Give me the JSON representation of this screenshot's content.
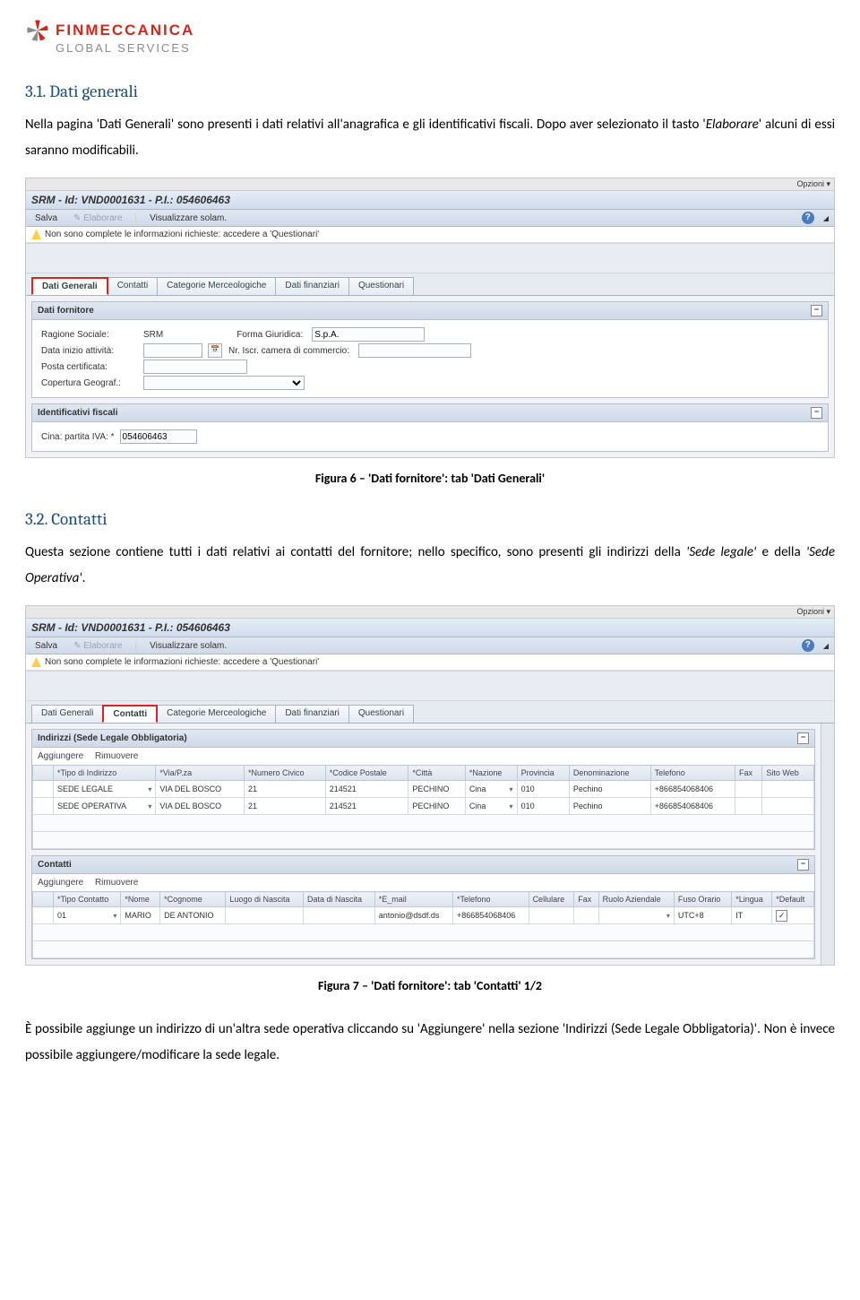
{
  "logo": {
    "brand": "FINMECCANICA",
    "sub": "GLOBAL SERVICES"
  },
  "section1": {
    "num": "3.1.",
    "title": "Dati generali",
    "para": "Nella pagina 'Dati Generali' sono presenti i dati relativi all'anagrafica e gli identificativi fiscali. Dopo aver selezionato il tasto 'Elaborare' alcuni di essi saranno modificabili."
  },
  "fig6": "Figura 6 – 'Dati fornitore': tab 'Dati Generali'",
  "section2": {
    "num": "3.2.",
    "title": "Contatti",
    "para": "Questa sezione contiene tutti i dati relativi ai contatti del fornitore; nello specifico, sono presenti gli indirizzi della 'Sede legale' e della 'Sede Operativa'."
  },
  "fig7": "Figura 7 – 'Dati fornitore': tab 'Contatti' 1/2",
  "footer": "È possibile aggiunge un indirizzo di un'altra sede operativa cliccando su 'Aggiungere' nella sezione 'Indirizzi (Sede Legale Obbligatoria)'. Non è invece possibile aggiungere/modificare la sede legale.",
  "srm": {
    "opzioni": "Opzioni ▾",
    "title": "SRM - Id: VND0001631 - P.I.: 054606463",
    "salva": "Salva",
    "elaborare": "Elaborare",
    "visualizzare": "Visualizzare solam.",
    "warn": "Non sono complete le informazioni richieste: accedere a 'Questionari'",
    "tabs": [
      "Dati Generali",
      "Contatti",
      "Categorie Merceologiche",
      "Dati finanziari",
      "Questionari"
    ],
    "panel_dati": "Dati fornitore",
    "panel_ident": "Identificativi fiscali",
    "form": {
      "ragione_l": "Ragione Sociale:",
      "ragione_v": "SRM",
      "forma_l": "Forma Giuridica:",
      "forma_v": "S.p.A.",
      "data_l": "Data inizio attività:",
      "iscr_l": "Nr. Iscr. camera di commercio:",
      "posta_l": "Posta certificata:",
      "geo_l": "Copertura Geograf.:",
      "iva_l": "Cina: partita IVA: *",
      "iva_v": "054606463"
    },
    "indirizzi_hd": "Indirizzi (Sede Legale Obbligatoria)",
    "aggiungere": "Aggiungere",
    "rimuovere": "Rimuovere",
    "addr_cols": [
      "*Tipo di Indirizzo",
      "*Via/P.za",
      "*Numero Civico",
      "*Codice Postale",
      "*Città",
      "*Nazione",
      "Provincia",
      "Denominazione",
      "Telefono",
      "Fax",
      "Sito Web"
    ],
    "addr_rows": [
      {
        "tipo": "SEDE LEGALE",
        "via": "VIA DEL BOSCO",
        "num": "21",
        "cap": "214521",
        "citta": "PECHINO",
        "naz": "Cina",
        "prov": "010",
        "den": "Pechino",
        "tel": "+866854068406",
        "fax": "",
        "sito": ""
      },
      {
        "tipo": "SEDE OPERATIVA",
        "via": "VIA DEL BOSCO",
        "num": "21",
        "cap": "214521",
        "citta": "PECHINO",
        "naz": "Cina",
        "prov": "010",
        "den": "Pechino",
        "tel": "+866854068406",
        "fax": "",
        "sito": ""
      }
    ],
    "contatti_hd": "Contatti",
    "cont_cols": [
      "*Tipo Contatto",
      "*Nome",
      "*Cognome",
      "Luogo di Nascita",
      "Data di Nascita",
      "*E_mail",
      "*Telefono",
      "Cellulare",
      "Fax",
      "Ruolo Aziendale",
      "Fuso Orario",
      "*Lingua",
      "*Default"
    ],
    "cont_rows": [
      {
        "tipo": "01",
        "nome": "MARIO",
        "cognome": "DE ANTONIO",
        "luogo": "",
        "data": "",
        "email": "antonio@dsdf.ds",
        "tel": "+866854068406",
        "cell": "",
        "fax": "",
        "ruolo": "",
        "fuso": "UTC+8",
        "lingua": "IT",
        "def": "✓"
      }
    ]
  }
}
